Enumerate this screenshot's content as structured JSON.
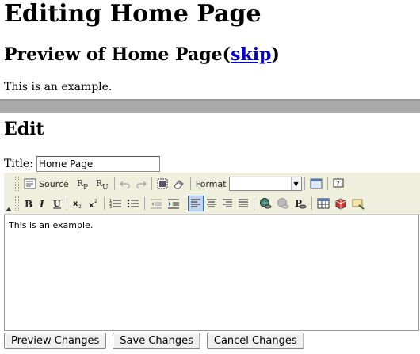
{
  "page": {
    "heading": "Editing Home Page",
    "preview_heading": "Preview of Home Page(",
    "preview_skip_link": "skip",
    "preview_heading_end": ")",
    "preview_body": "This is an example.",
    "edit_heading": "Edit"
  },
  "form": {
    "title_label": "Title:",
    "title_value": "Home Page"
  },
  "editor": {
    "toolbar": {
      "source_label": "Source",
      "format_label": "Format",
      "format_value": ""
    },
    "content": "This is an example."
  },
  "actions": {
    "preview_label": "Preview Changes",
    "save_label": "Save Changes",
    "cancel_label": "Cancel Changes"
  },
  "colors": {
    "link": "#0000cc",
    "toolbar_bg": "#efefde",
    "active_button_bg": "#c1d2ee",
    "active_button_border": "#316ac5"
  }
}
